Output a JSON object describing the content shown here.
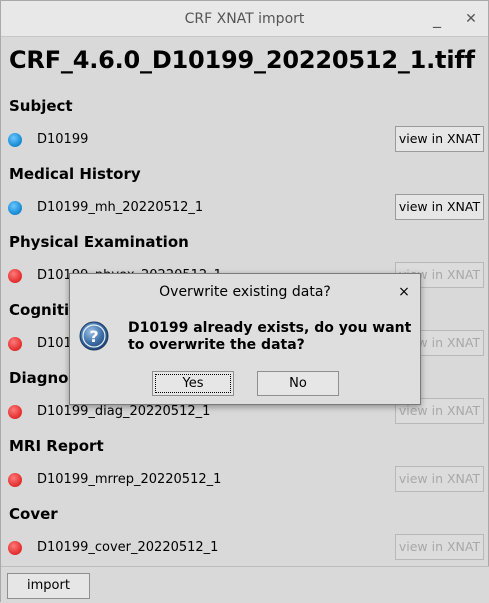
{
  "window": {
    "title": "CRF XNAT import",
    "minimize_glyph": "_",
    "close_glyph": "✕"
  },
  "filename": "CRF_4.6.0_D10199_20220512_1.tiff",
  "sections": [
    {
      "title": "Subject",
      "value": "D10199",
      "status": "blue",
      "button": "view in XNAT",
      "enabled": true
    },
    {
      "title": "Medical History",
      "value": "D10199_mh_20220512_1",
      "status": "blue",
      "button": "view in XNAT",
      "enabled": true
    },
    {
      "title": "Physical Examination",
      "value": "D10199_phyex_20220512_1",
      "status": "red",
      "button": "view in XNAT",
      "enabled": false
    },
    {
      "title": "Cognitive",
      "value": "D10199_cog_20220512_1",
      "status": "red",
      "button": "view in XNAT",
      "enabled": false
    },
    {
      "title": "Diagnosis",
      "value": "D10199_diag_20220512_1",
      "status": "red",
      "button": "view in XNAT",
      "enabled": false
    },
    {
      "title": "MRI Report",
      "value": "D10199_mrrep_20220512_1",
      "status": "red",
      "button": "view in XNAT",
      "enabled": false
    },
    {
      "title": "Cover",
      "value": "D10199_cover_20220512_1",
      "status": "red",
      "button": "view in XNAT",
      "enabled": false
    }
  ],
  "colors": {
    "blue_status": "#1e90d8",
    "red_status": "#e63535"
  },
  "import_label": "import",
  "dialog": {
    "title": "Overwrite existing data?",
    "close_glyph": "×",
    "icon": "question-icon",
    "message": "D10199 already exists, do you want to overwrite the data?",
    "yes_label": "Yes",
    "no_label": "No"
  }
}
